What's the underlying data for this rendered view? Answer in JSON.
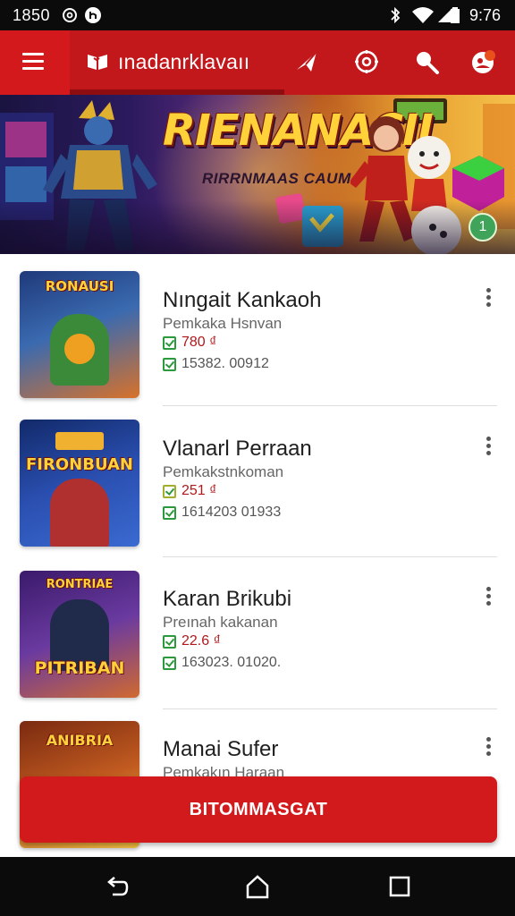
{
  "status_bar": {
    "time_left": "1850",
    "time_right": "9:76",
    "icons": [
      "at-icon",
      "notification-icon",
      "bluetooth-icon",
      "wifi-icon",
      "signal-icon",
      "battery-icon"
    ]
  },
  "app_bar": {
    "title": "ınadanrklavaıı",
    "icons": [
      "menu-icon",
      "logo-icon",
      "send-icon",
      "settings-icon",
      "search-icon",
      "profile-icon"
    ]
  },
  "banner": {
    "title": "RIENANACII",
    "subtitle": "RIRRNMAAS CAUM",
    "badge": "1",
    "page_count": 4,
    "active_page": 0
  },
  "items": [
    {
      "thumb_title": "RONAUSI",
      "title": "Nıngait Kankaoh",
      "subtitle": "Pemkaka Hsnvan",
      "price": "780 ₫",
      "meta": "15382. 00912",
      "colors": [
        "#1f3a7a",
        "#3a6ab0",
        "#d8722a"
      ]
    },
    {
      "thumb_title": "FIRONBUAN",
      "title": "Vlanarl Perraan",
      "subtitle": "Pemkakstnkoman",
      "price": "251 ₫",
      "meta": "1614203 01933",
      "colors": [
        "#122a6a",
        "#2a4fb0",
        "#f0b030"
      ]
    },
    {
      "thumb_title": "PITRIBAN",
      "title": "Karan Brikubi",
      "subtitle": "Preınah kakanan",
      "price": "22.6 ₫",
      "meta": "163023. 01020.",
      "colors": [
        "#3a1a6a",
        "#6a3aa0",
        "#f0a030"
      ]
    },
    {
      "thumb_title": "ANIBRIA",
      "title": "Manai Sufer",
      "subtitle": "Pemkakın Haraan",
      "price": "",
      "meta": "",
      "colors": [
        "#7a2a10",
        "#c05a20",
        "#f0c040"
      ]
    }
  ],
  "cta": {
    "label": "BITOMMASGAT"
  },
  "nav_bar": {
    "icons": [
      "back-icon",
      "home-icon",
      "recents-icon"
    ]
  },
  "colors": {
    "primary": "#c2181c",
    "accent_green": "#2c9a3c",
    "price_red": "#b0181c"
  }
}
